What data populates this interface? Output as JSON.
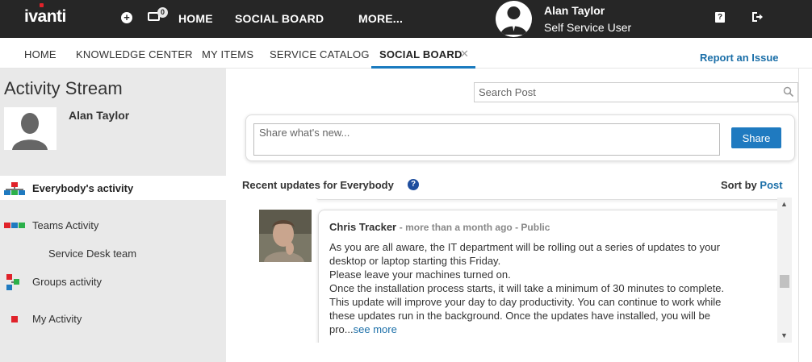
{
  "topbar": {
    "logo": "ivanti",
    "notification_count": "0",
    "nav": [
      "HOME",
      "SOCIAL BOARD",
      "MORE..."
    ],
    "user_name": "Alan Taylor",
    "user_role": "Self Service User"
  },
  "tabs": {
    "items": [
      "HOME",
      "KNOWLEDGE CENTER",
      "MY ITEMS",
      "SERVICE CATALOG",
      "SOCIAL BOARD"
    ],
    "active": "SOCIAL BOARD",
    "report_link": "Report an Issue"
  },
  "sidebar": {
    "title": "Activity Stream",
    "user_name": "Alan Taylor",
    "items": [
      {
        "label": "Everybody's activity"
      },
      {
        "label": "Teams Activity"
      },
      {
        "label": "Service Desk team"
      },
      {
        "label": "Groups activity"
      },
      {
        "label": "My Activity"
      }
    ]
  },
  "main": {
    "search_placeholder": "Search Post",
    "share_placeholder": "Share what's new...",
    "share_button": "Share",
    "recent_label": "Recent updates for Everybody",
    "help_glyph": "?",
    "sort_label": "Sort by",
    "sort_value": "Post"
  },
  "post": {
    "author": "Chris Tracker",
    "meta": "- more than a month ago - Public",
    "body_lines": [
      "As you are all aware, the IT department will be rolling out a series of updates to your",
      "desktop or laptop starting this Friday.",
      "Please leave your machines turned on.",
      "Once the installation process starts, it will take a minimum of 30 minutes to complete.",
      "This update will improve your day to day productivity. You can continue to work while",
      "these updates run in the background. Once the updates have installed, you will be",
      "pro..."
    ],
    "see_more": "see more"
  },
  "colors": {
    "topbar": "#262626",
    "accent": "#1f7ac0",
    "link": "#1b6fa8",
    "sidebar_bg": "#e9e9e9"
  }
}
